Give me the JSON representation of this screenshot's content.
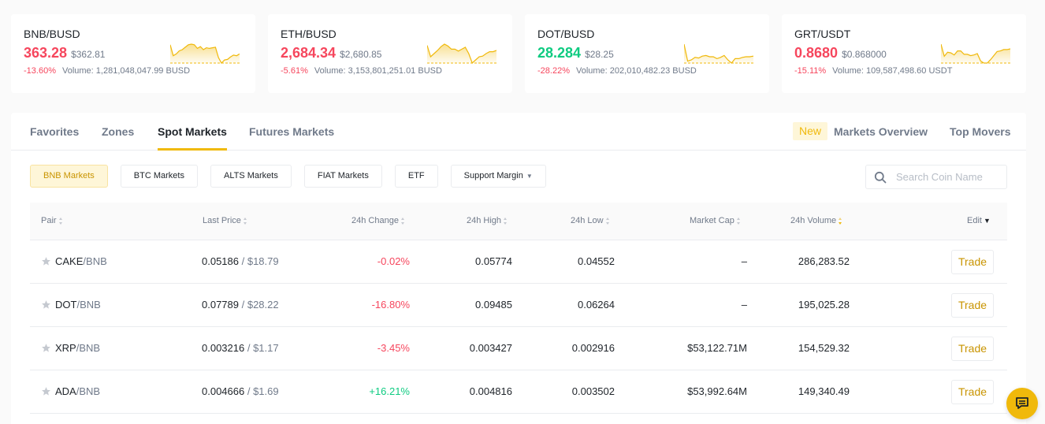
{
  "colors": {
    "accent": "#f0b90b",
    "down": "#f6465d",
    "up": "#0ecb81",
    "muted": "#707a8a"
  },
  "ticker_cards": [
    {
      "pair": "BNB/BUSD",
      "price": "363.28",
      "price_direction": "down",
      "usd": "$362.81",
      "change": "-13.60%",
      "volume": "Volume: 1,281,048,047.99 BUSD",
      "sparkline": [
        30,
        12,
        15,
        20,
        22,
        26,
        30,
        31,
        30,
        24,
        27,
        22,
        25,
        24,
        25,
        26,
        9,
        0,
        5,
        6,
        10,
        13,
        12,
        15
      ]
    },
    {
      "pair": "ETH/BUSD",
      "price": "2,684.34",
      "price_direction": "down",
      "usd": "$2,680.85",
      "change": "-5.61%",
      "volume": "Volume: 3,153,801,251.01 BUSD",
      "sparkline": [
        28,
        10,
        15,
        20,
        26,
        30,
        27,
        22,
        22,
        19,
        22,
        25,
        15,
        0,
        5,
        10,
        11,
        15,
        18,
        18,
        20
      ]
    },
    {
      "pair": "DOT/BUSD",
      "price": "28.284",
      "price_direction": "up",
      "usd": "$28.25",
      "change": "-28.22%",
      "volume": "Volume: 202,010,482.23 BUSD",
      "sparkline": [
        30,
        3,
        5,
        9,
        8,
        11,
        12,
        10,
        10,
        7,
        9,
        12,
        5,
        0,
        7,
        7,
        9,
        10,
        10,
        11
      ]
    },
    {
      "pair": "GRT/USDT",
      "price": "0.8680",
      "price_direction": "down",
      "usd": "$0.868000",
      "change": "-15.11%",
      "volume": "Volume: 109,587,498.60 USDT",
      "sparkline": [
        28,
        10,
        16,
        15,
        12,
        18,
        18,
        13,
        13,
        11,
        12,
        14,
        3,
        0,
        0,
        5,
        11,
        17,
        18,
        20,
        20,
        21
      ]
    }
  ],
  "tabs": [
    {
      "label": "Favorites",
      "active": false
    },
    {
      "label": "Zones",
      "active": false
    },
    {
      "label": "Spot Markets",
      "active": true
    },
    {
      "label": "Futures Markets",
      "active": false
    }
  ],
  "right_tabs": {
    "new_badge": "New",
    "markets_overview": "Markets Overview",
    "top_movers": "Top Movers"
  },
  "filters": [
    {
      "label": "BNB Markets",
      "active": true
    },
    {
      "label": "BTC Markets",
      "active": false
    },
    {
      "label": "ALTS Markets",
      "active": false
    },
    {
      "label": "FIAT Markets",
      "active": false
    },
    {
      "label": "ETF",
      "active": false
    },
    {
      "label": "Support Margin",
      "active": false,
      "dropdown": true
    }
  ],
  "search": {
    "placeholder": "Search Coin Name",
    "value": ""
  },
  "table": {
    "columns": [
      "Pair",
      "Last Price",
      "24h Change",
      "24h High",
      "24h Low",
      "Market Cap",
      "24h Volume",
      "Edit"
    ],
    "sorted_column": "24h Volume",
    "rows": [
      {
        "base": "CAKE",
        "quote": "/BNB",
        "last_price": "0.05186",
        "last_price_usd": " / $18.79",
        "change": "-0.02%",
        "change_direction": "down",
        "high": "0.05774",
        "low": "0.04552",
        "market_cap": "–",
        "volume": "286,283.52",
        "action": "Trade"
      },
      {
        "base": "DOT",
        "quote": "/BNB",
        "last_price": "0.07789",
        "last_price_usd": " / $28.22",
        "change": "-16.80%",
        "change_direction": "down",
        "high": "0.09485",
        "low": "0.06264",
        "market_cap": "–",
        "volume": "195,025.28",
        "action": "Trade"
      },
      {
        "base": "XRP",
        "quote": "/BNB",
        "last_price": "0.003216",
        "last_price_usd": " / $1.17",
        "change": "-3.45%",
        "change_direction": "down",
        "high": "0.003427",
        "low": "0.002916",
        "market_cap": "$53,122.71M",
        "volume": "154,529.32",
        "action": "Trade"
      },
      {
        "base": "ADA",
        "quote": "/BNB",
        "last_price": "0.004666",
        "last_price_usd": " / $1.69",
        "change": "+16.21%",
        "change_direction": "up",
        "high": "0.004816",
        "low": "0.003502",
        "market_cap": "$53,992.64M",
        "volume": "149,340.49",
        "action": "Trade"
      }
    ]
  },
  "icons": {
    "star": "star-icon",
    "search": "search-icon",
    "chat": "chat-icon",
    "sort": "sort-icon"
  }
}
